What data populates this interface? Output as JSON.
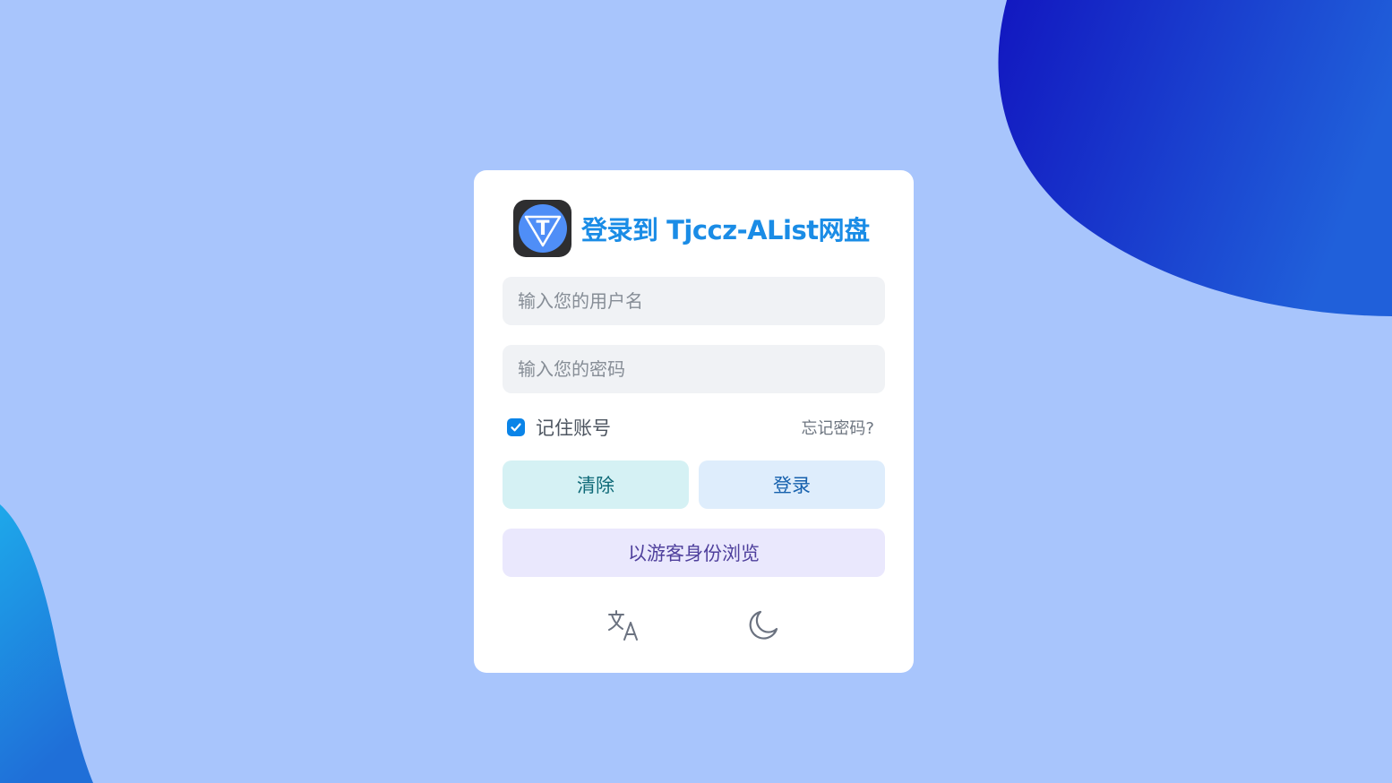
{
  "login": {
    "title": "登录到 Tjccz-AList网盘",
    "username_placeholder": "输入您的用户名",
    "password_placeholder": "输入您的密码",
    "remember_label": "记住账号",
    "remember_checked": true,
    "forgot_label": "忘记密码?",
    "clear_label": "清除",
    "login_label": "登录",
    "guest_label": "以游客身份浏览",
    "logo_letter": "T"
  },
  "icons": {
    "logo": "logo-icon",
    "checkbox": "check-icon",
    "language": "translate-icon",
    "theme": "moon-icon"
  },
  "colors": {
    "background": "#a8c5fc",
    "blob_dark": "#1520c4",
    "blob_light": "#1f9be6",
    "accent": "#1a8ce6",
    "checkbox": "#0a84e8"
  }
}
